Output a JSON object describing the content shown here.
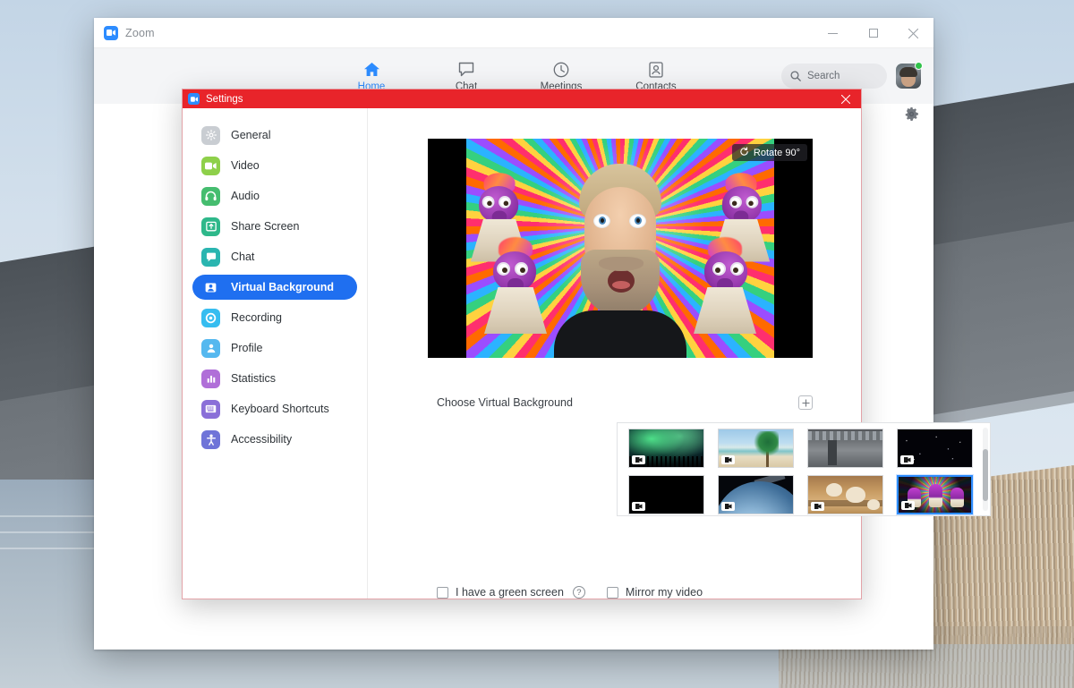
{
  "desktop": {
    "wallpaper_name": "lake-dune-reeds-wallpaper"
  },
  "window": {
    "title": "Zoom",
    "logo_icon": "zoom-camera-icon",
    "controls": {
      "minimize": "—",
      "maximize": "□",
      "close": "✕"
    },
    "gear_icon": "gear-icon"
  },
  "nav": {
    "tabs": [
      {
        "label": "Home",
        "icon": "home-icon",
        "active": true
      },
      {
        "label": "Chat",
        "icon": "chat-bubble-icon",
        "active": false
      },
      {
        "label": "Meetings",
        "icon": "clock-icon",
        "active": false
      },
      {
        "label": "Contacts",
        "icon": "contact-card-icon",
        "active": false
      }
    ],
    "search": {
      "placeholder": "Search",
      "value": "",
      "icon": "search-icon"
    },
    "avatar": {
      "name": "avatar",
      "presence": "online",
      "presence_color": "#30c24a"
    }
  },
  "settings": {
    "title": "Settings",
    "logo_icon": "zoom-camera-icon",
    "titlebar_color": "#e8242a",
    "close_label": "✕",
    "sidebar": {
      "items": [
        {
          "label": "General",
          "icon": "gear-icon",
          "color": "#c9cdd2",
          "active": false
        },
        {
          "label": "Video",
          "icon": "video-camera-icon",
          "color": "#8ed04a",
          "active": false
        },
        {
          "label": "Audio",
          "icon": "headphones-icon",
          "color": "#45bd6f",
          "active": false
        },
        {
          "label": "Share Screen",
          "icon": "share-screen-icon",
          "color": "#2eb88a",
          "active": false
        },
        {
          "label": "Chat",
          "icon": "chat-bubble-icon",
          "color": "#2ab5b0",
          "active": false
        },
        {
          "label": "Virtual Background",
          "icon": "person-frame-icon",
          "color": "#1f6ff0",
          "active": true
        },
        {
          "label": "Recording",
          "icon": "record-circle-icon",
          "color": "#36bdf0",
          "active": false
        },
        {
          "label": "Profile",
          "icon": "person-icon",
          "color": "#55b8ef",
          "active": false
        },
        {
          "label": "Statistics",
          "icon": "bar-chart-icon",
          "color": "#b06fd8",
          "active": false
        },
        {
          "label": "Keyboard Shortcuts",
          "icon": "keyboard-icon",
          "color": "#8a6fd8",
          "active": false
        },
        {
          "label": "Accessibility",
          "icon": "accessibility-icon",
          "color": "#6f74d8",
          "active": false
        }
      ]
    },
    "preview": {
      "rotate_label": "Rotate 90°",
      "rotate_icon": "rotate-icon",
      "description": "self-view-with-virtual-background"
    },
    "choose_section": {
      "label": "Choose Virtual Background",
      "add_icon": "plus-square-icon"
    },
    "backgrounds": [
      {
        "name": "aurora-borealis",
        "art": "art-aurora",
        "video_badge": true,
        "selected": false
      },
      {
        "name": "tropical-beach",
        "art": "art-beach",
        "video_badge": true,
        "selected": false
      },
      {
        "name": "spaceship-interior",
        "art": "art-ship",
        "video_badge": false,
        "selected": false
      },
      {
        "name": "starfield",
        "art": "art-stars",
        "video_badge": true,
        "selected": false
      },
      {
        "name": "black",
        "art": "art-black",
        "video_badge": true,
        "selected": false
      },
      {
        "name": "earth-from-space",
        "art": "art-earth",
        "video_badge": true,
        "selected": false
      },
      {
        "name": "puppies-on-steps",
        "art": "art-pups",
        "video_badge": true,
        "selected": false
      },
      {
        "name": "puppet-rainbow",
        "art": "art-muppet",
        "video_badge": true,
        "selected": true
      }
    ],
    "options": [
      {
        "label": "I have a green screen",
        "checked": false,
        "help_icon": "question-mark-icon",
        "help_glyph": "?"
      },
      {
        "label": "Mirror my video",
        "checked": false,
        "help_icon": null,
        "help_glyph": ""
      }
    ]
  }
}
